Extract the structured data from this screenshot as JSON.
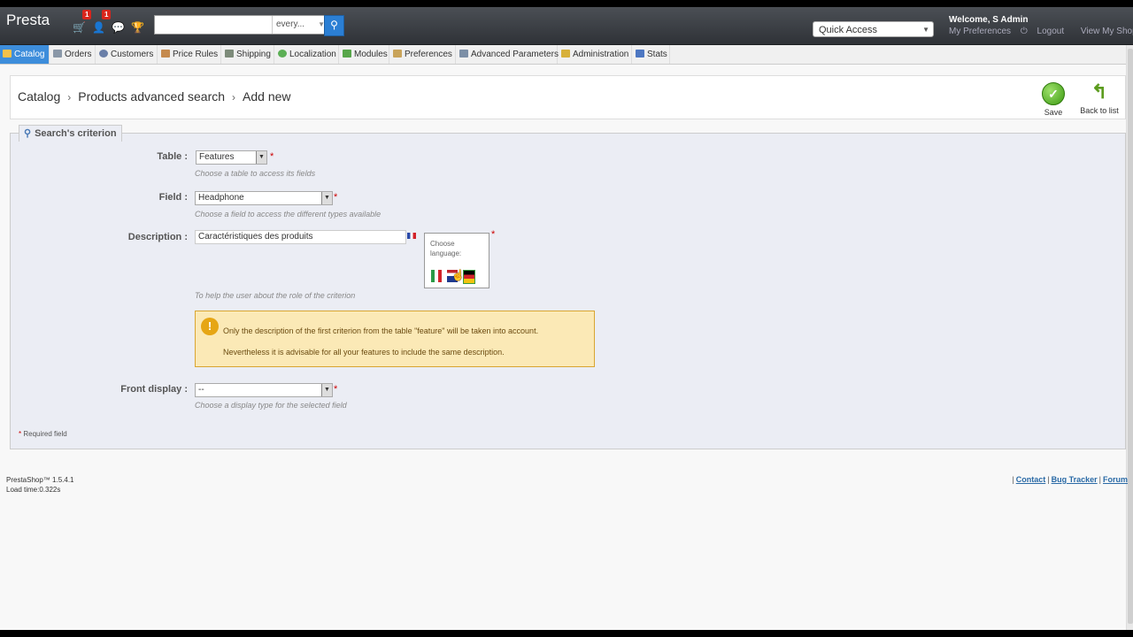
{
  "header": {
    "logo": "Presta",
    "badges": {
      "orders": "1",
      "customers": "1"
    },
    "search_scope": "every...",
    "quick_access": "Quick Access",
    "welcome_prefix": "Welcome, ",
    "welcome_user": "S Admin",
    "links": {
      "preferences": "My Preferences",
      "logout": "Logout",
      "view_shop": "View My Shop"
    }
  },
  "nav": {
    "tabs": [
      {
        "label": "Catalog"
      },
      {
        "label": "Orders"
      },
      {
        "label": "Customers"
      },
      {
        "label": "Price Rules"
      },
      {
        "label": "Shipping"
      },
      {
        "label": "Localization"
      },
      {
        "label": "Modules"
      },
      {
        "label": "Preferences"
      },
      {
        "label": "Advanced Parameters"
      },
      {
        "label": "Administration"
      },
      {
        "label": "Stats"
      }
    ]
  },
  "breadcrumb": {
    "items": [
      "Catalog",
      "Products advanced search",
      "Add new"
    ]
  },
  "toolbar": {
    "save_label": "Save",
    "back_label": "Back to list"
  },
  "form": {
    "legend": "Search's criterion",
    "table": {
      "label": "Table :",
      "value": "Features",
      "hint": "Choose a table to access its fields"
    },
    "field": {
      "label": "Field :",
      "value": "Headphone",
      "hint": "Choose a field to access the different types available"
    },
    "description": {
      "label": "Description :",
      "value": "Caractéristiques des produits",
      "hint": "To help the user about the role of the criterion"
    },
    "language_popup": {
      "line1": "Choose",
      "line2": "language:"
    },
    "warning": {
      "line1": "Only the description of the first criterion from the table \"feature\" will be taken into account.",
      "line2": "Nevertheless it is advisable for all your features to include the same description."
    },
    "front_display": {
      "label": "Front display :",
      "value": "--",
      "hint": "Choose a display type for the selected field"
    },
    "required_marker": "*",
    "required_note": "Required field"
  },
  "footer": {
    "version": "PrestaShop™ 1.5.4.1",
    "load_time": "Load time:0.322s",
    "links": {
      "contact": "Contact",
      "bug_tracker": "Bug Tracker",
      "forum": "Forum"
    }
  },
  "colors": {
    "accent": "#3d8ddb",
    "warning_bg": "#fbe9b6",
    "header": "#3a3d42"
  }
}
